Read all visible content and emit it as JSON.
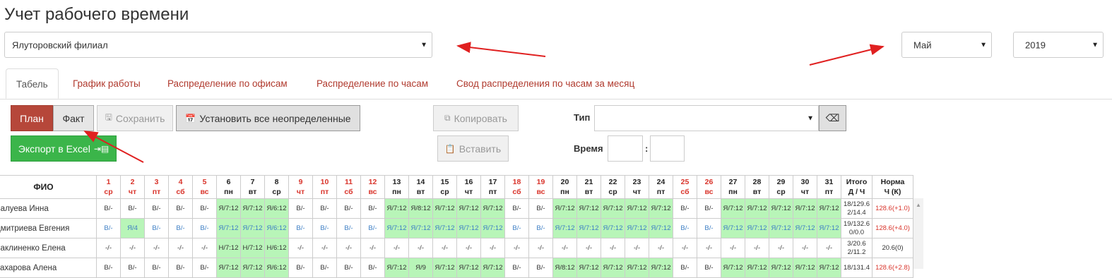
{
  "page": {
    "title": "Учет рабочего времени",
    "branch_select": "Ялуторовский филиал",
    "month_select": "Май",
    "year_select": "2019"
  },
  "tabs": [
    {
      "label": "Табель",
      "active": true
    },
    {
      "label": "График работы",
      "active": false
    },
    {
      "label": "Распределение по офисам",
      "active": false
    },
    {
      "label": "Распределение по часам",
      "active": false
    },
    {
      "label": "Свод распределения по часам за месяц",
      "active": false
    }
  ],
  "toolbar": {
    "plan_label": "План",
    "fact_label": "Факт",
    "save_label": "Сохранить",
    "set_undefined_label": "Установить все неопределенные",
    "copy_label": "Копировать",
    "paste_label": "Вставить",
    "export_label": "Экспорт в Excel",
    "type_label": "Тип",
    "type_value": "",
    "time_label": "Время",
    "time_sep": ":"
  },
  "colors": {
    "accent_red": "#b6473a",
    "export_green": "#3bb54a",
    "cell_green": "#b8f5b8",
    "weekend_red": "#d9342b",
    "link_red": "#b03a2e"
  },
  "table": {
    "name_header": "ФИО",
    "days": [
      {
        "d": "1",
        "w": "ср",
        "we": true
      },
      {
        "d": "2",
        "w": "чт",
        "we": true
      },
      {
        "d": "3",
        "w": "пт",
        "we": true
      },
      {
        "d": "4",
        "w": "сб",
        "we": true
      },
      {
        "d": "5",
        "w": "вс",
        "we": true
      },
      {
        "d": "6",
        "w": "пн",
        "we": false
      },
      {
        "d": "7",
        "w": "вт",
        "we": false
      },
      {
        "d": "8",
        "w": "ср",
        "we": false
      },
      {
        "d": "9",
        "w": "чт",
        "we": true
      },
      {
        "d": "10",
        "w": "пт",
        "we": true
      },
      {
        "d": "11",
        "w": "сб",
        "we": true
      },
      {
        "d": "12",
        "w": "вс",
        "we": true
      },
      {
        "d": "13",
        "w": "пн",
        "we": false
      },
      {
        "d": "14",
        "w": "вт",
        "we": false
      },
      {
        "d": "15",
        "w": "ср",
        "we": false
      },
      {
        "d": "16",
        "w": "чт",
        "we": false
      },
      {
        "d": "17",
        "w": "пт",
        "we": false
      },
      {
        "d": "18",
        "w": "сб",
        "we": true
      },
      {
        "d": "19",
        "w": "вс",
        "we": true
      },
      {
        "d": "20",
        "w": "пн",
        "we": false
      },
      {
        "d": "21",
        "w": "вт",
        "we": false
      },
      {
        "d": "22",
        "w": "ср",
        "we": false
      },
      {
        "d": "23",
        "w": "чт",
        "we": false
      },
      {
        "d": "24",
        "w": "пт",
        "we": false
      },
      {
        "d": "25",
        "w": "сб",
        "we": true
      },
      {
        "d": "26",
        "w": "вс",
        "we": true
      },
      {
        "d": "27",
        "w": "пн",
        "we": false
      },
      {
        "d": "28",
        "w": "вт",
        "we": false
      },
      {
        "d": "29",
        "w": "ср",
        "we": false
      },
      {
        "d": "30",
        "w": "чт",
        "we": false
      },
      {
        "d": "31",
        "w": "пт",
        "we": false
      }
    ],
    "total_header_1": "Итого",
    "total_header_2": "Д / Ч",
    "norm_header_1": "Норма",
    "norm_header_2": "Ч (К)",
    "rows": [
      {
        "name": "Валуева Инна",
        "cells": [
          "В/-",
          "В/-",
          "В/-",
          "В/-",
          "В/-",
          "Я/7:12",
          "Я/7:12",
          "Я/6:12",
          "В/-",
          "В/-",
          "В/-",
          "В/-",
          "Я/7:12",
          "Я/8:12",
          "Я/7:12",
          "Я/7:12",
          "Я/7:12",
          "В/-",
          "В/-",
          "Я/7:12",
          "Я/7:12",
          "Я/7:12",
          "Я/7:12",
          "Я/7:12",
          "В/-",
          "В/-",
          "Я/7:12",
          "Я/7:12",
          "Я/7:12",
          "Я/7:12",
          "Я/7:12"
        ],
        "green": [
          false,
          false,
          false,
          false,
          false,
          true,
          true,
          true,
          false,
          false,
          false,
          false,
          true,
          true,
          true,
          true,
          true,
          false,
          false,
          true,
          true,
          true,
          true,
          true,
          false,
          false,
          true,
          true,
          true,
          true,
          true
        ],
        "blue": false,
        "total_1": "18/129.6",
        "total_2": "2/14.4",
        "norm": "128.6(+1.0)",
        "norm_red": true
      },
      {
        "name": "Дмитриева Евгения",
        "cells": [
          "В/-",
          "Я/4",
          "В/-",
          "В/-",
          "В/-",
          "Я/7:12",
          "Я/7:12",
          "Я/6:12",
          "В/-",
          "В/-",
          "В/-",
          "В/-",
          "Я/7:12",
          "Я/7:12",
          "Я/7:12",
          "Я/7:12",
          "Я/7:12",
          "В/-",
          "В/-",
          "Я/7:12",
          "Я/7:12",
          "Я/7:12",
          "Я/7:12",
          "Я/7:12",
          "В/-",
          "В/-",
          "Я/7:12",
          "Я/7:12",
          "Я/7:12",
          "Я/7:12",
          "Я/7:12"
        ],
        "green": [
          false,
          true,
          false,
          false,
          false,
          true,
          true,
          true,
          false,
          false,
          false,
          false,
          true,
          true,
          true,
          true,
          true,
          false,
          false,
          true,
          true,
          true,
          true,
          true,
          false,
          false,
          true,
          true,
          true,
          true,
          true
        ],
        "blue": true,
        "total_1": "19/132.6",
        "total_2": "0/0.0",
        "norm": "128.6(+4.0)",
        "norm_red": true
      },
      {
        "name": "Баклиненко Елена",
        "cells": [
          "-/-",
          "-/-",
          "-/-",
          "-/-",
          "-/-",
          "Н/7:12",
          "Н/7:12",
          "Н/6:12",
          "-/-",
          "-/-",
          "-/-",
          "-/-",
          "-/-",
          "-/-",
          "-/-",
          "-/-",
          "-/-",
          "-/-",
          "-/-",
          "-/-",
          "-/-",
          "-/-",
          "-/-",
          "-/-",
          "-/-",
          "-/-",
          "-/-",
          "-/-",
          "-/-",
          "-/-",
          "-/-"
        ],
        "green": [
          false,
          false,
          false,
          false,
          false,
          true,
          true,
          true,
          false,
          false,
          false,
          false,
          false,
          false,
          false,
          false,
          false,
          false,
          false,
          false,
          false,
          false,
          false,
          false,
          false,
          false,
          false,
          false,
          false,
          false,
          false
        ],
        "blue": false,
        "total_1": "3/20.6",
        "total_2": "2/11.2",
        "norm": "20.6(0)",
        "norm_red": false
      },
      {
        "name": "Захарова Алена",
        "cells": [
          "В/-",
          "В/-",
          "В/-",
          "В/-",
          "В/-",
          "Я/7:12",
          "Я/7:12",
          "Я/6:12",
          "В/-",
          "В/-",
          "В/-",
          "В/-",
          "Я/7:12",
          "Я/9",
          "Я/7:12",
          "Я/7:12",
          "Я/7:12",
          "В/-",
          "В/-",
          "Я/8:12",
          "Я/7:12",
          "Я/7:12",
          "Я/7:12",
          "Я/7:12",
          "В/-",
          "В/-",
          "Я/7:12",
          "Я/7:12",
          "Я/7:12",
          "Я/7:12",
          "Я/7:12"
        ],
        "green": [
          false,
          false,
          false,
          false,
          false,
          true,
          true,
          true,
          false,
          false,
          false,
          false,
          true,
          true,
          true,
          true,
          true,
          false,
          false,
          true,
          true,
          true,
          true,
          true,
          false,
          false,
          true,
          true,
          true,
          true,
          true
        ],
        "blue": false,
        "total_1": "18/131.4",
        "total_2": "",
        "norm": "128.6(+2.8)",
        "norm_red": true
      }
    ]
  }
}
